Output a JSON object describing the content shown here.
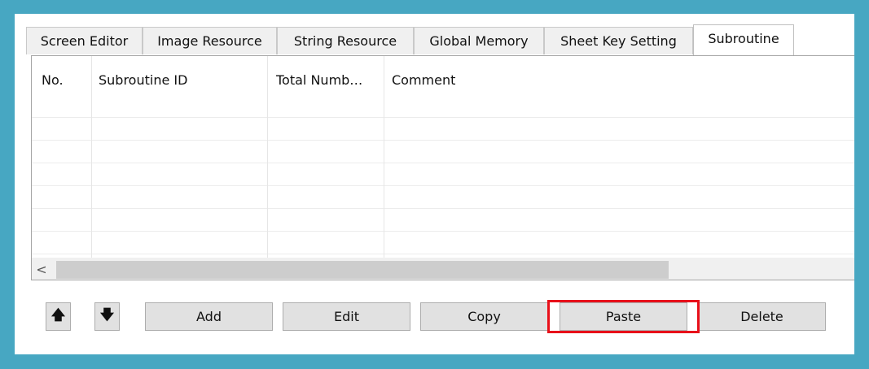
{
  "tabs": [
    {
      "label": "Screen Editor",
      "active": false
    },
    {
      "label": "Image Resource",
      "active": false
    },
    {
      "label": "String Resource",
      "active": false
    },
    {
      "label": "Global Memory",
      "active": false
    },
    {
      "label": "Sheet Key Setting",
      "active": false
    },
    {
      "label": "Subroutine",
      "active": true
    }
  ],
  "table": {
    "columns": [
      "No.",
      "Subroutine ID",
      "Total Numb…",
      "Comment"
    ],
    "rows": []
  },
  "scrollbar": {
    "left_arrow": "<"
  },
  "buttons": {
    "up_icon": "🡅",
    "down_icon": "🡇",
    "add": "Add",
    "edit": "Edit",
    "copy": "Copy",
    "paste": "Paste",
    "delete": "Delete"
  },
  "highlight_color": "#e8101a",
  "accent_background": "#47a7c2"
}
